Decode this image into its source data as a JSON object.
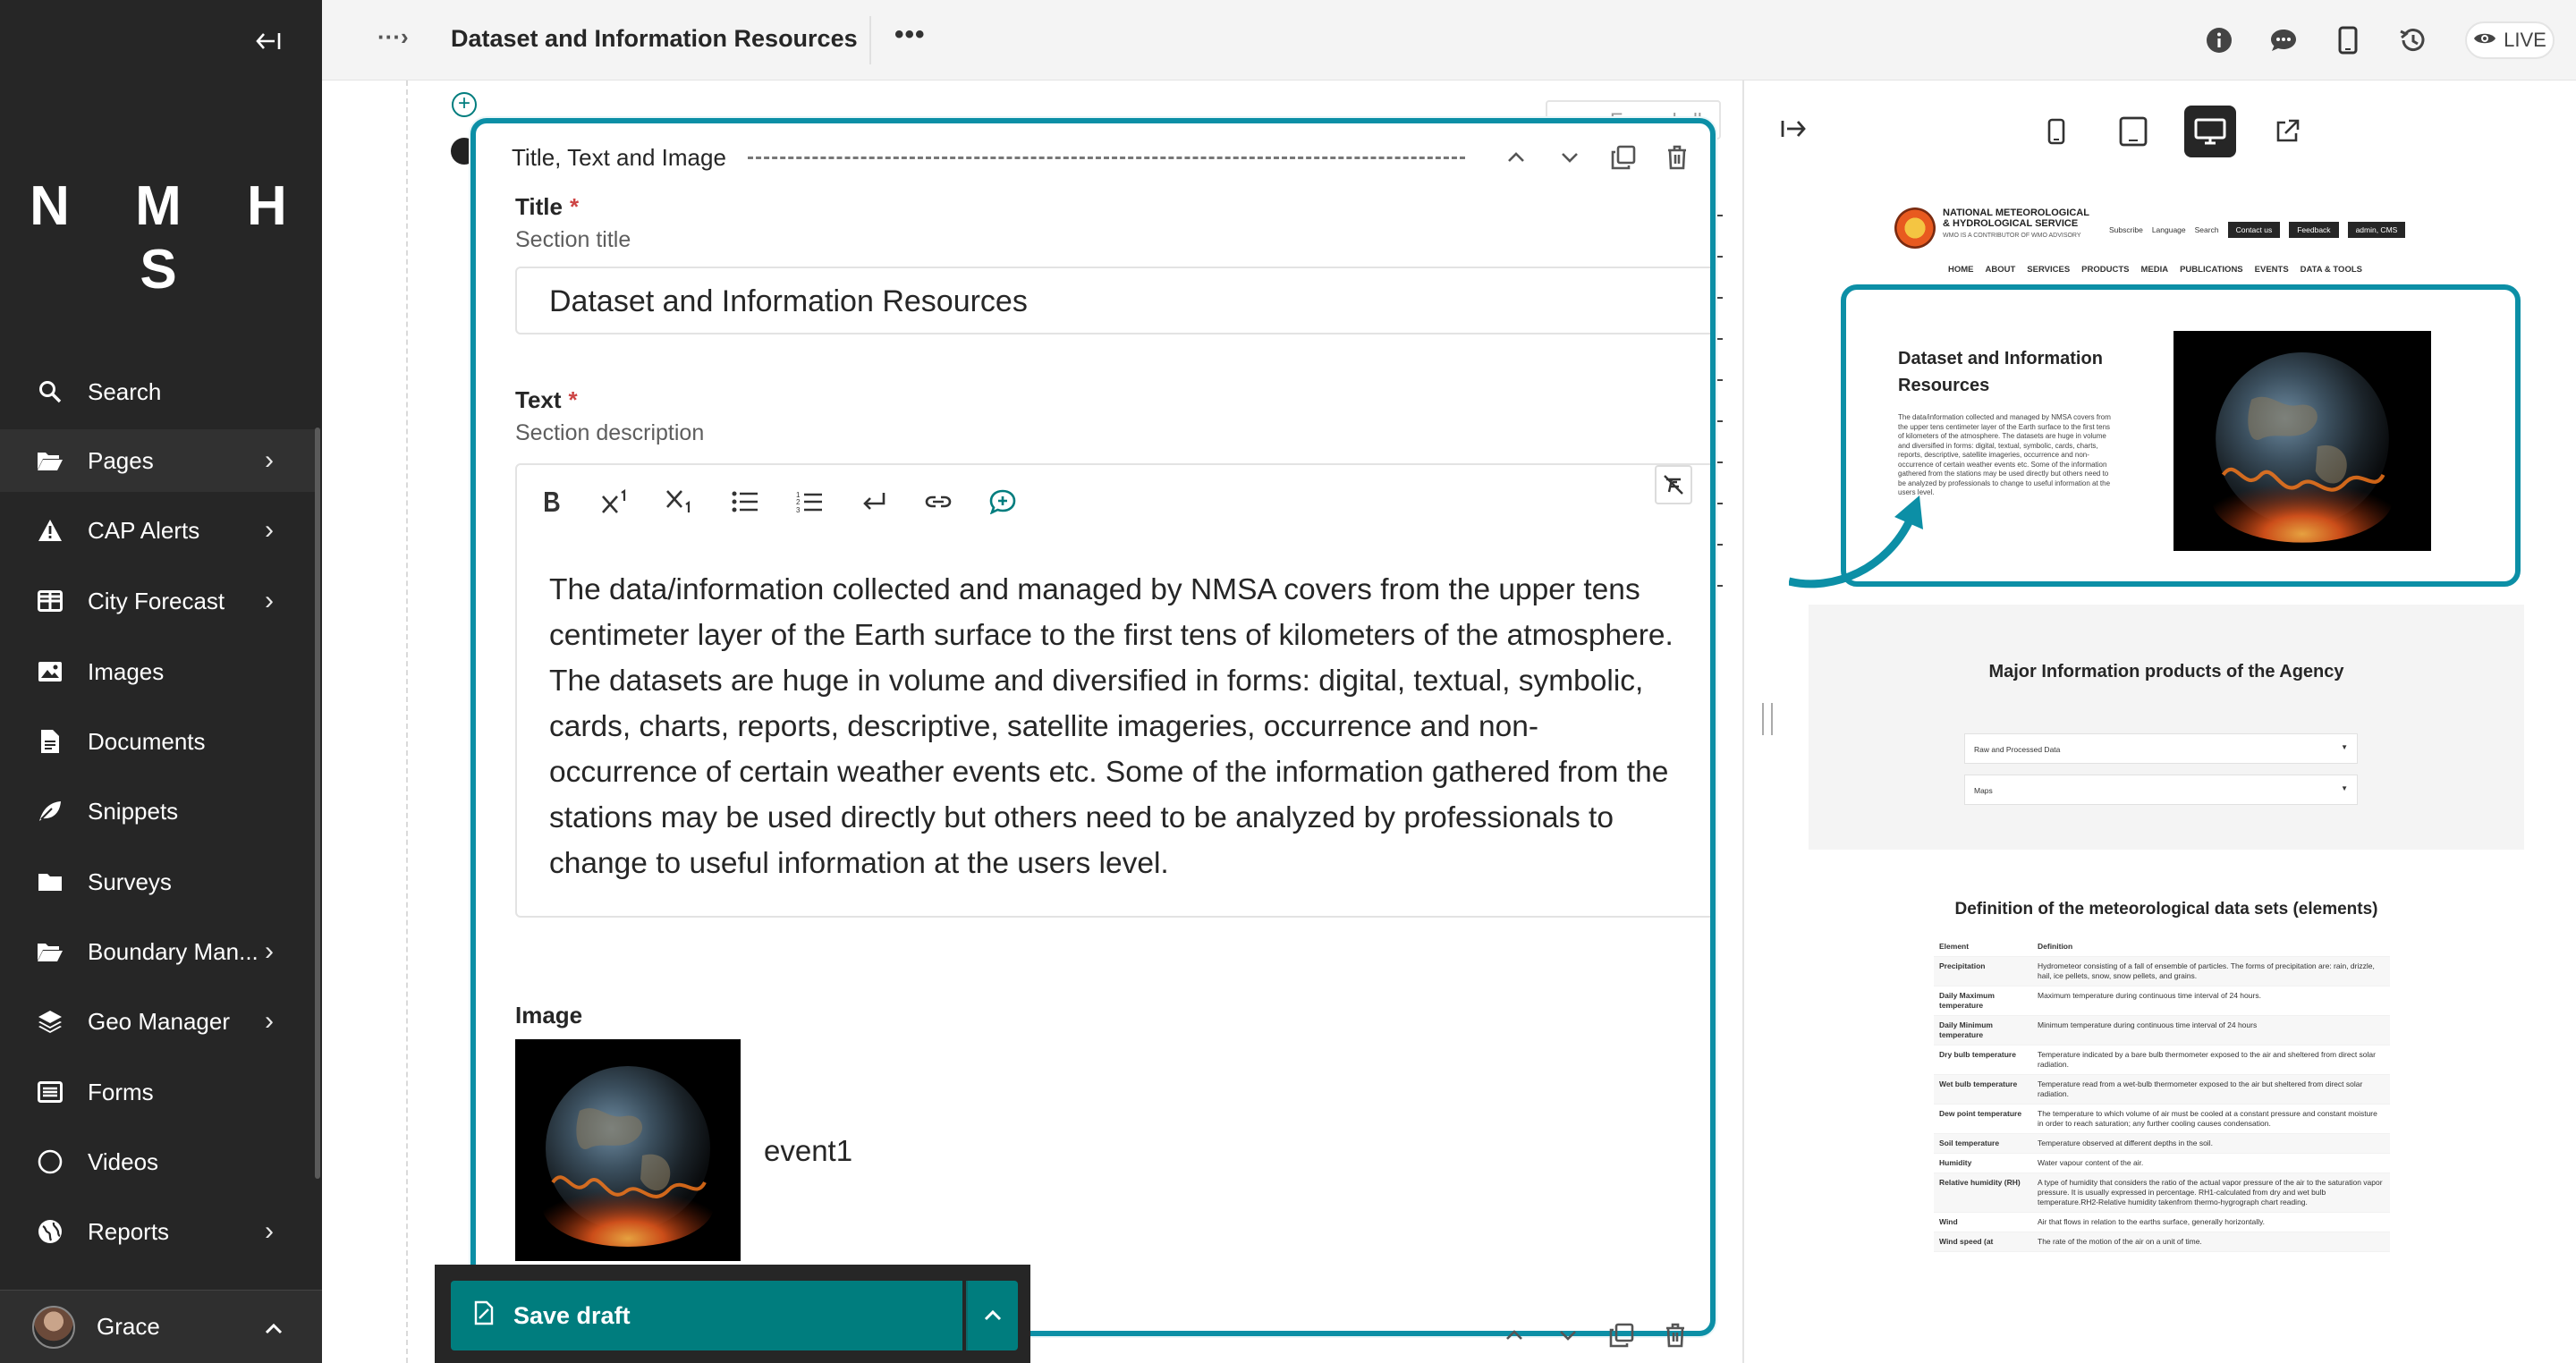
{
  "sidebar": {
    "logo": "N M H S",
    "items": [
      {
        "label": "Search",
        "icon": "search-icon",
        "has_chevron": false
      },
      {
        "label": "Pages",
        "icon": "folder-open-icon",
        "has_chevron": true
      },
      {
        "label": "CAP Alerts",
        "icon": "warning-icon",
        "has_chevron": true
      },
      {
        "label": "City Forecast",
        "icon": "table-icon",
        "has_chevron": true
      },
      {
        "label": "Images",
        "icon": "image-icon",
        "has_chevron": false
      },
      {
        "label": "Documents",
        "icon": "document-icon",
        "has_chevron": false
      },
      {
        "label": "Snippets",
        "icon": "snippet-icon",
        "has_chevron": false
      },
      {
        "label": "Surveys",
        "icon": "folder-icon",
        "has_chevron": false
      },
      {
        "label": "Boundary Man...",
        "icon": "folder-open-icon",
        "has_chevron": true
      },
      {
        "label": "Geo Manager",
        "icon": "layers-icon",
        "has_chevron": true
      },
      {
        "label": "Forms",
        "icon": "list-icon",
        "has_chevron": false
      },
      {
        "label": "Videos",
        "icon": "circle-icon",
        "has_chevron": false
      },
      {
        "label": "Reports",
        "icon": "globe-icon",
        "has_chevron": true
      }
    ],
    "user": {
      "name": "Grace"
    }
  },
  "header": {
    "title": "Dataset and Information Resources",
    "live_label": "LIVE"
  },
  "editor": {
    "expand_all": "Expand all",
    "panel_title": "Title, Text and Image",
    "title_field": {
      "label": "Title",
      "required": "*",
      "help": "Section title",
      "value": "Dataset and Information Resources"
    },
    "text_field": {
      "label": "Text",
      "required": "*",
      "help": "Section description",
      "value": "The data/information collected and managed by NMSA covers from the upper tens centimeter layer of the Earth surface to the first tens of kilometers of the atmosphere. The datasets are huge in volume and diversified in forms: digital, textual, symbolic, cards, charts, reports, descriptive, satellite imageries, occurrence and non-occurrence of certain weather events etc. Some of the information gathered from the stations may be used directly but others need to be analyzed by professionals to change to useful information at the users level."
    },
    "image_field": {
      "label": "Image",
      "name": "event1"
    },
    "save_label": "Save draft"
  },
  "preview": {
    "site_name": "NATIONAL METEOROLOGICAL & HYDROLOGICAL SERVICE",
    "site_tagline": "WMO IS A CONTRIBUTOR OF WMO ADVISORY",
    "util": {
      "subscribe": "Subscribe",
      "language": "Language",
      "search": "Search",
      "contact": "Contact us",
      "feedback": "Feedback",
      "admin": "admin, CMS"
    },
    "nav": [
      "HOME",
      "ABOUT",
      "SERVICES",
      "PRODUCTS",
      "MEDIA",
      "PUBLICATIONS",
      "EVENTS",
      "DATA & TOOLS"
    ],
    "highlight_title": "Dataset and Information Resources",
    "highlight_text": "The data/information collected and managed by NMSA covers from the upper tens centimeter layer of the Earth surface to the first tens of kilometers of the atmosphere. The datasets are huge in volume and diversified in forms: digital, textual, symbolic, cards, charts, reports, descriptive, satellite imageries, occurrence and non-occurrence of certain weather events etc. Some of the information gathered from the stations may be used directly but others need to be analyzed by professionals to change to useful information at the users level.",
    "products_title": "Major Information products of the Agency",
    "accordions": [
      "Raw and Processed Data",
      "Maps"
    ],
    "definitions_title": "Definition of the meteorological data sets (elements)",
    "table_headers": [
      "Element",
      "Definition"
    ],
    "table_rows": [
      [
        "Precipitation",
        "Hydrometeor consisting of a fall of ensemble of particles. The forms of precipitation are: rain, drizzle, hail, ice pellets, snow, snow pellets, and grains."
      ],
      [
        "Daily Maximum temperature",
        "Maximum temperature during continuous time interval of 24 hours."
      ],
      [
        "Daily Minimum temperature",
        "Minimum temperature during continuous time interval of 24 hours"
      ],
      [
        "Dry bulb temperature",
        "Temperature indicated by a bare bulb thermometer exposed to the air and sheltered from direct solar radiation."
      ],
      [
        "Wet bulb temperature",
        "Temperature read from a wet-bulb thermometer exposed to the air but sheltered from direct solar radiation."
      ],
      [
        "Dew point temperature",
        "The temperature to which volume of air must be cooled at a constant pressure and constant moisture in order to reach saturation; any further cooling causes condensation."
      ],
      [
        "Soil temperature",
        "Temperature observed at different depths in the soil."
      ],
      [
        "Humidity",
        "Water vapour content of the air."
      ],
      [
        "Relative humidity (RH)",
        "A type of humidity that considers the ratio of the actual vapor pressure of the air to the saturation vapor pressure. It is usually expressed in percentage. RH1-calculated from dry and wet bulb temperature.RH2-Relative humidity takenfrom thermo-hygrograph chart reading."
      ],
      [
        "Wind",
        "Air that flows in relation to the earths surface, generally horizontally."
      ],
      [
        "Wind speed (at",
        "The rate of the motion of the air on a unit of time."
      ]
    ]
  },
  "colors": {
    "accent": "#007d7e",
    "highlight": "#0c8fa6",
    "sidebar": "#262626"
  }
}
